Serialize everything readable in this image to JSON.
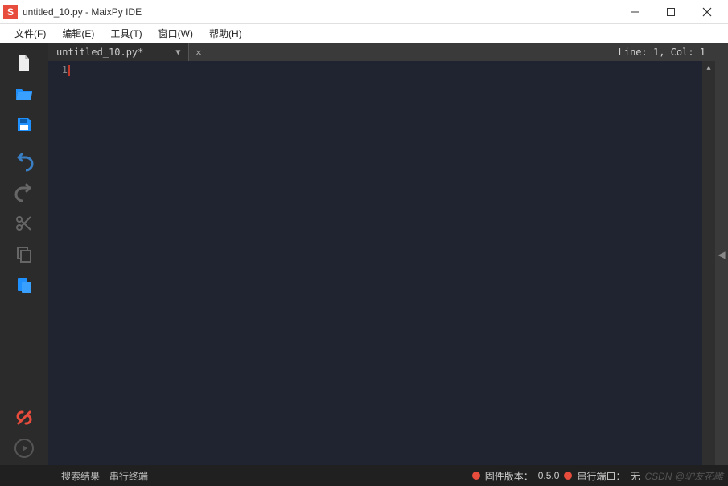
{
  "titlebar": {
    "app_icon_letter": "S",
    "title": "untitled_10.py - MaixPy IDE"
  },
  "menubar": {
    "items": [
      "文件(F)",
      "编辑(E)",
      "工具(T)",
      "窗口(W)",
      "帮助(H)"
    ]
  },
  "editor": {
    "tab": {
      "label": "untitled_10.py*"
    },
    "cursor_info": "Line: 1, Col: 1",
    "gutter": {
      "line1": "1"
    }
  },
  "statusbar": {
    "tabs": {
      "search": "搜索结果",
      "terminal": "串行终端"
    },
    "firmware_label": "固件版本：",
    "firmware_value": "0.5.0",
    "serial_label": "串行端口：",
    "serial_value": "无",
    "watermark": "CSDN @驴友花雕"
  },
  "colors": {
    "accent_red": "#e74c3c",
    "blue": "#1e90ff",
    "bg_dark": "#1f2430"
  }
}
